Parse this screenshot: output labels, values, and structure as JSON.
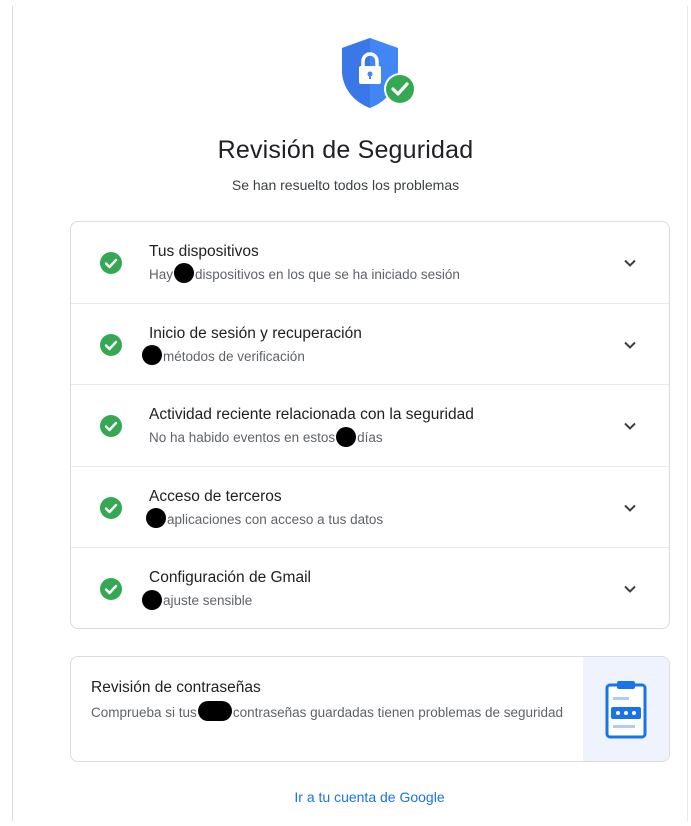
{
  "header": {
    "icon": "shield-lock-check-icon",
    "title": "Revisión de Seguridad",
    "subtitle": "Se han resuelto todos los problemas"
  },
  "items": [
    {
      "title": "Tus dispositivos",
      "sub_before": "Hay",
      "sub_after": "dispositivos en los que se ha iniciado sesión",
      "status": "ok"
    },
    {
      "title": "Inicio de sesión y recuperación",
      "sub_before": "",
      "sub_after": "métodos de verificación",
      "status": "ok"
    },
    {
      "title": "Actividad reciente relacionada con la seguridad",
      "sub_before": "No ha habido eventos en estos",
      "sub_after": "días",
      "status": "ok"
    },
    {
      "title": "Acceso de terceros",
      "sub_before": "",
      "sub_after": "aplicaciones con acceso a tus datos",
      "status": "ok"
    },
    {
      "title": "Configuración de Gmail",
      "sub_before": "",
      "sub_after": "ajuste sensible",
      "status": "ok"
    }
  ],
  "password_check": {
    "title": "Revisión de contraseñas",
    "desc_before": "Comprueba si tus",
    "desc_after": "contraseñas guardadas tienen problemas de seguridad",
    "icon": "clipboard-password-icon"
  },
  "footer": {
    "link": "Ir a tu cuenta de Google"
  },
  "colors": {
    "shield": "#4285f4",
    "check": "#34a853",
    "link": "#1a73e8"
  }
}
